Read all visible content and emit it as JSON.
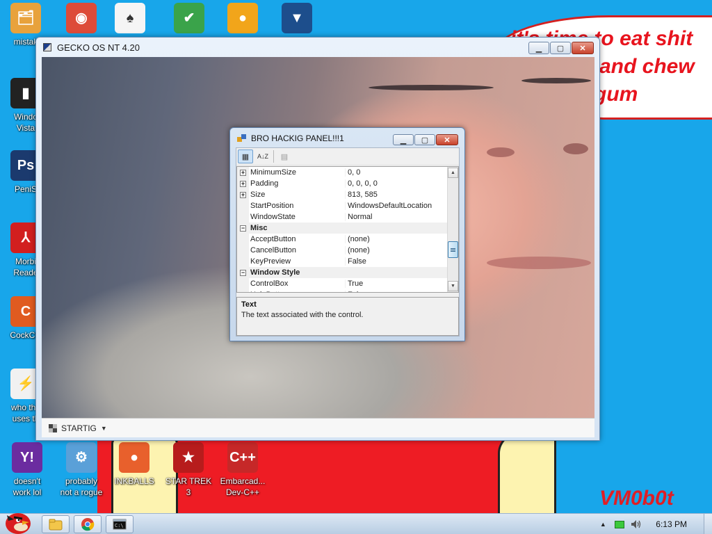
{
  "wallpaper": {
    "speech_lines": [
      "it's time to eat shit",
      "and chew",
      "gum"
    ],
    "signature": "VM0b0t",
    "colors": {
      "sky": "#18a6ea",
      "red": "#ee1c24",
      "yellow": "#fdf3b0",
      "text_red": "#e8141e"
    }
  },
  "desktop_icons": [
    {
      "label": "mistak",
      "icon": "folder-tools-icon",
      "color": "#e8a23c"
    },
    {
      "label": "",
      "icon": "chrome-icon",
      "color": "#dd4b39"
    },
    {
      "label": "",
      "icon": "solitaire-icon",
      "color": "#f5f5f5"
    },
    {
      "label": "",
      "icon": "shield-check-icon",
      "color": "#3aa34a"
    },
    {
      "label": "",
      "icon": "angry-birds-pig-icon",
      "color": "#f2a51a"
    },
    {
      "label": "",
      "icon": "bat-logo-icon",
      "color": "#1d4e8c"
    },
    {
      "label": "Windo\nVista",
      "icon": "trash-bin-icon",
      "color": "#222222"
    },
    {
      "label": "PeniS",
      "icon": "photoshop-icon",
      "color": "#1b3a6e"
    },
    {
      "label": "Morbi\nReade",
      "icon": "acrobat-icon",
      "color": "#d21f1f"
    },
    {
      "label": "CockCle",
      "icon": "ccleaner-icon",
      "color": "#e05b20"
    },
    {
      "label": "who the\nuses th",
      "icon": "lightning-icon",
      "color": "#f1f1f1"
    },
    {
      "label": "doesn't\nwork lol",
      "icon": "yahoo-messenger-icon",
      "color": "#6b2ca0"
    },
    {
      "label": "probably\nnot a rogue",
      "icon": "gear-monitor-icon",
      "color": "#5aa0d8"
    },
    {
      "label": "INKBALLS",
      "icon": "inkball-icon",
      "color": "#e8602c"
    },
    {
      "label": "STAR TREK\n3",
      "icon": "star-wars-icon",
      "color": "#b71c1c"
    },
    {
      "label": "Embarcad...\nDev-C++",
      "icon": "dev-cpp-icon",
      "color": "#c62828"
    }
  ],
  "main_window": {
    "title": "GECKO OS NT 4.20",
    "status_start_label": "STARTIG",
    "buttons": {
      "minimize": "▁",
      "maximize": "▢",
      "close": "✕"
    }
  },
  "dialog": {
    "title": "BRO HACKIG PANEL!!!1",
    "toolbar": {
      "categorized": "▦",
      "alphabetical": "A↓Z",
      "property_pages": "▤"
    },
    "rows": [
      {
        "type": "prop",
        "expand": "+",
        "name": "MinimumSize",
        "value": "0, 0"
      },
      {
        "type": "prop",
        "expand": "+",
        "name": "Padding",
        "value": "0, 0, 0, 0"
      },
      {
        "type": "prop",
        "expand": "+",
        "name": "Size",
        "value": "813, 585"
      },
      {
        "type": "prop",
        "expand": "",
        "name": "StartPosition",
        "value": "WindowsDefaultLocation"
      },
      {
        "type": "prop",
        "expand": "",
        "name": "WindowState",
        "value": "Normal"
      },
      {
        "type": "cat",
        "expand": "−",
        "name": "Misc",
        "value": ""
      },
      {
        "type": "prop",
        "expand": "",
        "name": "AcceptButton",
        "value": "(none)"
      },
      {
        "type": "prop",
        "expand": "",
        "name": "CancelButton",
        "value": "(none)"
      },
      {
        "type": "prop",
        "expand": "",
        "name": "KeyPreview",
        "value": "False"
      },
      {
        "type": "cat",
        "expand": "−",
        "name": "Window Style",
        "value": ""
      },
      {
        "type": "prop",
        "expand": "",
        "name": "ControlBox",
        "value": "True"
      },
      {
        "type": "prop",
        "expand": "",
        "name": "HelpButton",
        "value": "False"
      }
    ],
    "description": {
      "title": "Text",
      "text": "The text associated with the control."
    }
  },
  "taskbar": {
    "clock": "6:13 PM",
    "buttons": [
      "explorer-icon",
      "chrome-icon",
      "cmd-icon"
    ],
    "tray": {
      "expand": "▲",
      "network": "▆",
      "volume": "🔊"
    }
  }
}
